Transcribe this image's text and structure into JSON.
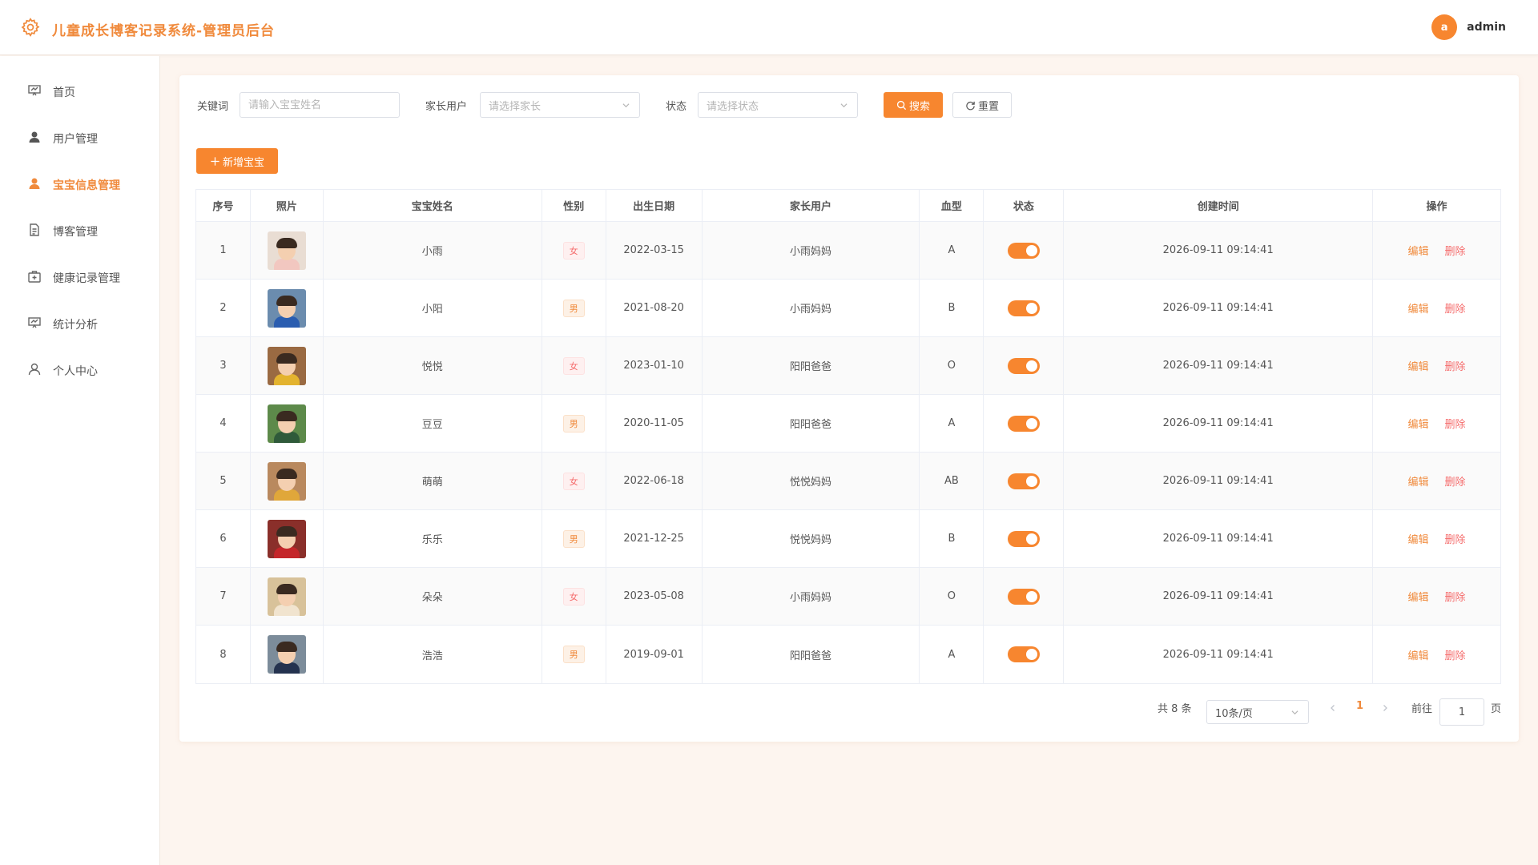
{
  "app": {
    "title": "儿童成长博客记录系统-管理员后台",
    "user": {
      "avatar_letter": "a",
      "name": "admin"
    },
    "brand_color": "#f08a3c"
  },
  "sidebar": {
    "items": [
      {
        "label": "首页",
        "icon": "dashboard-icon",
        "active": false
      },
      {
        "label": "用户管理",
        "icon": "user-icon",
        "active": false
      },
      {
        "label": "宝宝信息管理",
        "icon": "baby-icon",
        "active": true
      },
      {
        "label": "博客管理",
        "icon": "document-icon",
        "active": false
      },
      {
        "label": "健康记录管理",
        "icon": "medical-kit-icon",
        "active": false
      },
      {
        "label": "统计分析",
        "icon": "chart-board-icon",
        "active": false
      },
      {
        "label": "个人中心",
        "icon": "person-outline-icon",
        "active": false
      }
    ]
  },
  "filters": {
    "keyword_label": "关键词",
    "keyword_placeholder": "请输入宝宝姓名",
    "parent_label": "家长用户",
    "parent_placeholder": "请选择家长",
    "status_label": "状态",
    "status_placeholder": "请选择状态",
    "search_label": "搜索",
    "reset_label": "重置"
  },
  "add_button_label": "新增宝宝",
  "table": {
    "headers": [
      "序号",
      "照片",
      "宝宝姓名",
      "性别",
      "出生日期",
      "家长用户",
      "血型",
      "状态",
      "创建时间",
      "操作"
    ],
    "edit_label": "编辑",
    "delete_label": "删除",
    "rows": [
      {
        "no": "1",
        "name": "小雨",
        "gender": "女",
        "birth": "2022-03-15",
        "parent": "小雨妈妈",
        "blood": "A",
        "enabled": true,
        "created": "2026-09-11 09:14:41",
        "photo_bg": "#e9ddd3",
        "shirt": "#f2c7c0"
      },
      {
        "no": "2",
        "name": "小阳",
        "gender": "男",
        "birth": "2021-08-20",
        "parent": "小雨妈妈",
        "blood": "B",
        "enabled": true,
        "created": "2026-09-11 09:14:41",
        "photo_bg": "#6b8cae",
        "shirt": "#2a5db0"
      },
      {
        "no": "3",
        "name": "悦悦",
        "gender": "女",
        "birth": "2023-01-10",
        "parent": "阳阳爸爸",
        "blood": "O",
        "enabled": true,
        "created": "2026-09-11 09:14:41",
        "photo_bg": "#9a6a42",
        "shirt": "#e3b32f"
      },
      {
        "no": "4",
        "name": "豆豆",
        "gender": "男",
        "birth": "2020-11-05",
        "parent": "阳阳爸爸",
        "blood": "A",
        "enabled": true,
        "created": "2026-09-11 09:14:41",
        "photo_bg": "#5d8a4a",
        "shirt": "#2f5a3a"
      },
      {
        "no": "5",
        "name": "萌萌",
        "gender": "女",
        "birth": "2022-06-18",
        "parent": "悦悦妈妈",
        "blood": "AB",
        "enabled": true,
        "created": "2026-09-11 09:14:41",
        "photo_bg": "#b9895e",
        "shirt": "#e0a73a"
      },
      {
        "no": "6",
        "name": "乐乐",
        "gender": "男",
        "birth": "2021-12-25",
        "parent": "悦悦妈妈",
        "blood": "B",
        "enabled": true,
        "created": "2026-09-11 09:14:41",
        "photo_bg": "#8a2f2a",
        "shirt": "#c4262a"
      },
      {
        "no": "7",
        "name": "朵朵",
        "gender": "女",
        "birth": "2023-05-08",
        "parent": "小雨妈妈",
        "blood": "O",
        "enabled": true,
        "created": "2026-09-11 09:14:41",
        "photo_bg": "#d8c29a",
        "shirt": "#f1e4cf"
      },
      {
        "no": "8",
        "name": "浩浩",
        "gender": "男",
        "birth": "2019-09-01",
        "parent": "阳阳爸爸",
        "blood": "A",
        "enabled": true,
        "created": "2026-09-11 09:14:41",
        "photo_bg": "#7c8c9a",
        "shirt": "#24324f"
      }
    ]
  },
  "pagination": {
    "total_text": "共 8 条",
    "page_size": "10条/页",
    "current_page": "1",
    "goto_label": "前往",
    "goto_value": "1",
    "page_suffix": "页"
  }
}
